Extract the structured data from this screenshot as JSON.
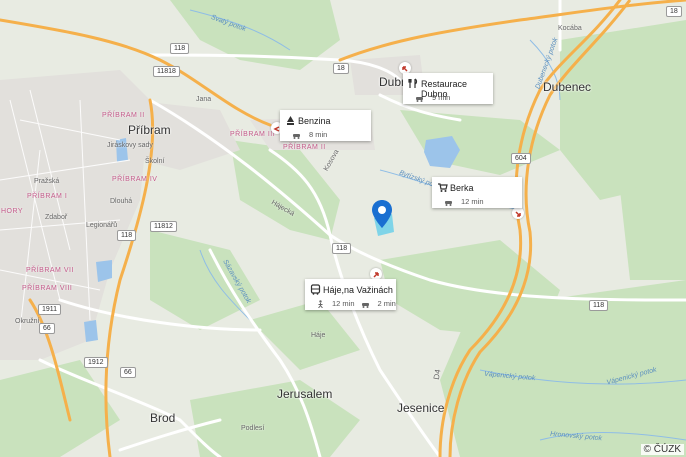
{
  "map": {
    "copyright": "© ČÚZK",
    "towns": [
      "Příbram",
      "Dubno",
      "Dubenec",
      "Jerusalem",
      "Jesenice",
      "Brod"
    ],
    "neighborhoods": [
      "PŘÍBRAM II",
      "PŘÍBRAM III",
      "PŘÍBRAM IV",
      "PŘÍBRAM VII",
      "PŘÍBRAM VIII",
      "PŘÍBRAM I",
      "PŘÍBRAM II",
      "HORY"
    ],
    "streets": [
      "Jana",
      "Školní",
      "Dlouhá",
      "Hájecká",
      "Legionářů",
      "Pražská",
      "Jiráskovy sady",
      "Okružní",
      "Háje",
      "Podlesí",
      "Zdaboř",
      "Kosova",
      "Kocába"
    ],
    "streams": [
      "Svatý potok",
      "Bytízský potok",
      "Sázavský potok",
      "Vápenický potok",
      "Vápenický potok",
      "Hronovský potok",
      "Dubenecký potok"
    ],
    "road_numbers": [
      "118",
      "18",
      "118",
      "18",
      "604",
      "11812",
      "118",
      "118",
      "1911",
      "1912",
      "66",
      "66",
      "118",
      "11818",
      "604",
      "18"
    ],
    "highway_label": "D4",
    "pin_color": "#1a6fd1",
    "colors": {
      "green": "#c9e2bd",
      "water": "#9cc4ea",
      "main_road": "#f5b04b",
      "road": "#ffffff",
      "urban": "#e2e0dc"
    }
  },
  "cards": [
    {
      "title": "Benzina",
      "icon": "gas-station-icon",
      "times": [
        {
          "mode": "car",
          "value": "8 min"
        }
      ]
    },
    {
      "title": "Restaurace Dubno",
      "icon": "restaurant-icon",
      "times": [
        {
          "mode": "car",
          "value": "9 min"
        }
      ]
    },
    {
      "title": "Berka",
      "icon": "cart-icon",
      "times": [
        {
          "mode": "car",
          "value": "12 min"
        }
      ]
    },
    {
      "title": "Háje,na Važinách",
      "icon": "bus-icon",
      "times": [
        {
          "mode": "walk",
          "value": "12 min"
        },
        {
          "mode": "car",
          "value": "2 min"
        }
      ]
    }
  ]
}
